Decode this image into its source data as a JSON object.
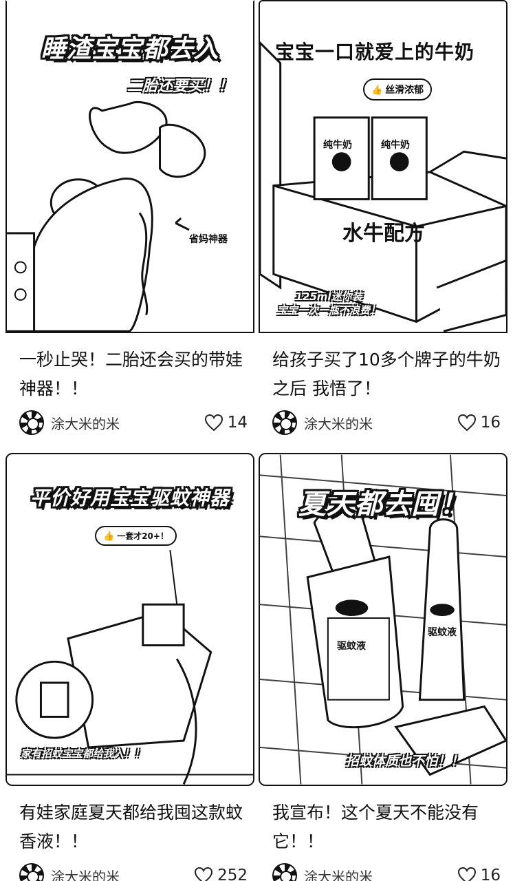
{
  "feed": {
    "cards": [
      {
        "cover_title": "睡渣宝宝都去入",
        "cover_subtitle": "二胎还要买！！",
        "cover_tag": "省妈神器",
        "title": "一秒止哭！二胎还会买的带娃神器！！",
        "author": "涂大米的米",
        "likes": "14"
      },
      {
        "cover_title": "宝宝一口就爱上的牛奶",
        "cover_pill": "丝滑浓郁",
        "cover_box_text": "纯牛奶",
        "cover_brand": "水牛配方",
        "cover_caption_1": "125ml迷你装",
        "cover_caption_2": "宝宝一次一瓶不浪费！",
        "title": "给孩子买了10多个牌子的牛奶之后 我悟了！",
        "author": "涂大米的米",
        "likes": "16"
      },
      {
        "cover_title": "平价好用宝宝驱蚊神器",
        "cover_pill": "一套才20+！",
        "cover_caption": "家有招蚊宝宝都给我入！！",
        "title": "有娃家庭夏天都给我囤这款蚊香液！！",
        "author": "涂大米的米",
        "likes": "252"
      },
      {
        "cover_title": "夏天都去囤！",
        "cover_bottle_label": "驱蚊液",
        "cover_caption": "招蚊体质也不怕！！",
        "title": "我宣布！这个夏天不能没有它！！",
        "author": "涂大米的米",
        "likes": "16"
      }
    ]
  }
}
